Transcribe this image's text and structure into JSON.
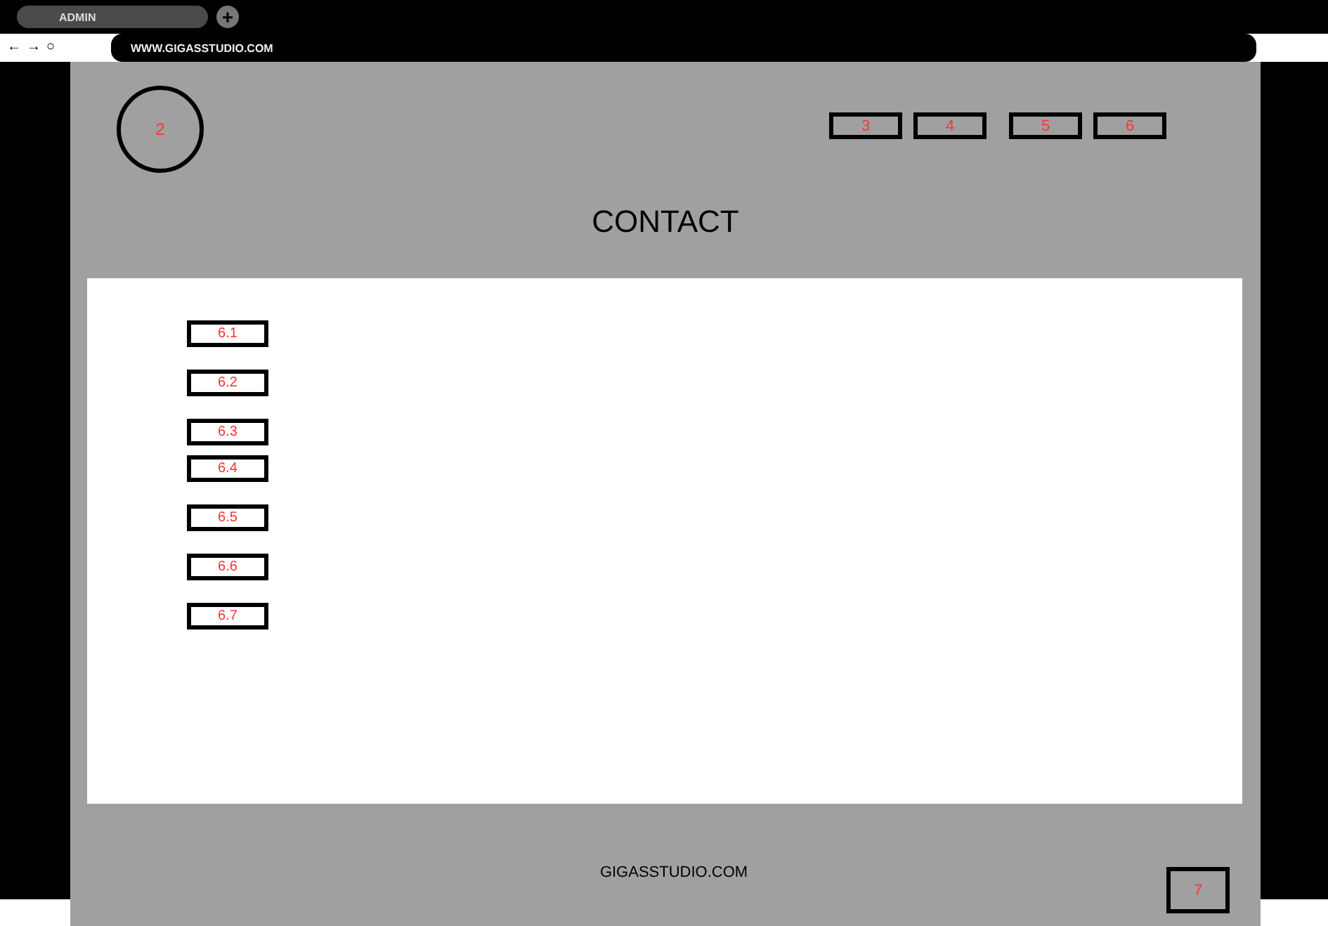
{
  "browser": {
    "tab": "ADMIN",
    "new_tab": "+",
    "back": "←",
    "forward": "→",
    "reload": "○",
    "address": "WWW.GIGASSTUDIO.COM"
  },
  "header": {
    "logo": "2",
    "nav": [
      "3",
      "4",
      "5",
      "6"
    ],
    "title": "CONTACT"
  },
  "content": {
    "items": [
      "6.1",
      "6.2",
      "6.3",
      "6.4",
      "6.5",
      "6.6",
      "6.7"
    ]
  },
  "footer": {
    "text": "GIGASSTUDIO.COM",
    "button": "7"
  }
}
